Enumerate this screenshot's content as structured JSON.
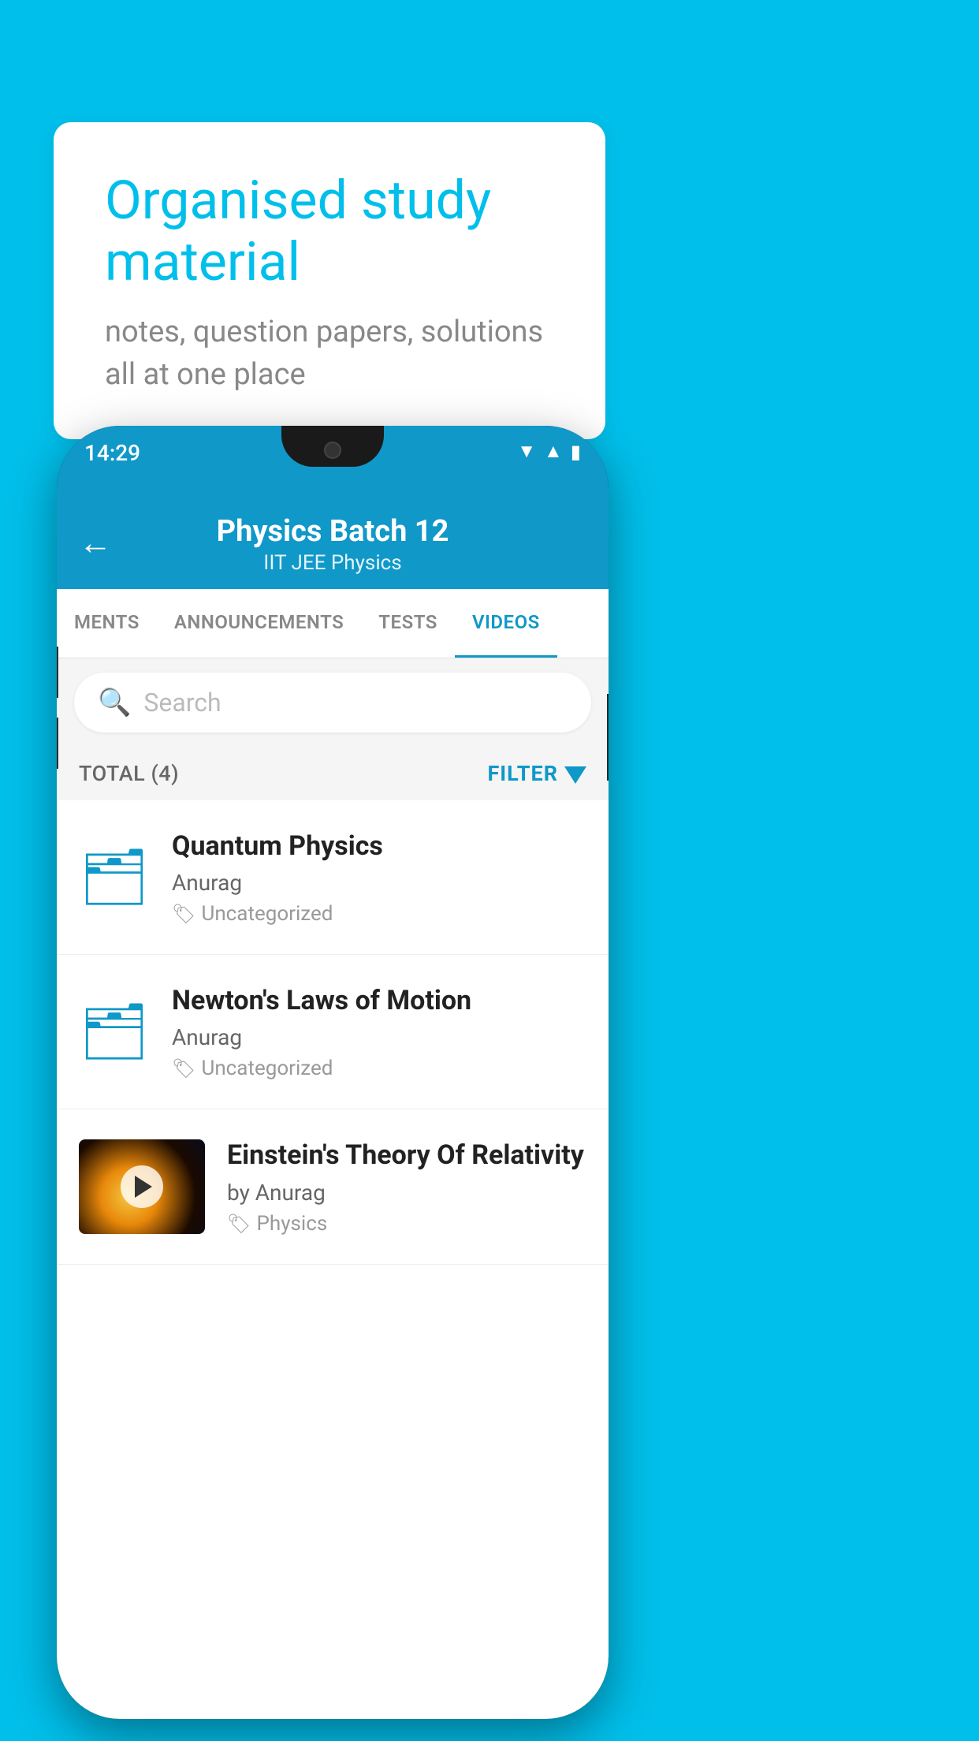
{
  "background_color": "#00BFEA",
  "bubble": {
    "title": "Organised study material",
    "subtitle": "notes, question papers, solutions all at one place"
  },
  "phone": {
    "status_time": "14:29",
    "header": {
      "title": "Physics Batch 12",
      "subtitle": "IIT JEE   Physics",
      "back_label": "←"
    },
    "tabs": [
      {
        "label": "MENTS",
        "active": false
      },
      {
        "label": "ANNOUNCEMENTS",
        "active": false
      },
      {
        "label": "TESTS",
        "active": false
      },
      {
        "label": "VIDEOS",
        "active": true
      }
    ],
    "search": {
      "placeholder": "Search"
    },
    "filter": {
      "total_label": "TOTAL (4)",
      "filter_label": "FILTER"
    },
    "videos": [
      {
        "id": 1,
        "title": "Quantum Physics",
        "author": "Anurag",
        "tag": "Uncategorized",
        "type": "folder"
      },
      {
        "id": 2,
        "title": "Newton's Laws of Motion",
        "author": "Anurag",
        "tag": "Uncategorized",
        "type": "folder"
      },
      {
        "id": 3,
        "title": "Einstein's Theory Of Relativity",
        "author": "by Anurag",
        "tag": "Physics",
        "type": "video"
      }
    ]
  }
}
